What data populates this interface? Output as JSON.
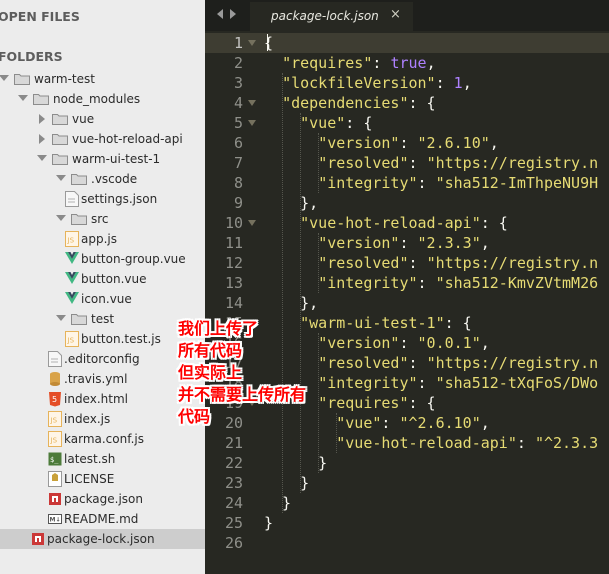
{
  "sidebar": {
    "open_files_label": "OPEN FILES",
    "folders_label": "FOLDERS",
    "tree": [
      {
        "label": "warm-test",
        "kind": "folder",
        "state": "open",
        "icon": "folder-open-icon"
      },
      {
        "label": "node_modules",
        "kind": "folder",
        "state": "open",
        "icon": "folder-open-icon"
      },
      {
        "label": "vue",
        "kind": "folder",
        "state": "closed",
        "icon": "folder-icon"
      },
      {
        "label": "vue-hot-reload-api",
        "kind": "folder",
        "state": "closed",
        "icon": "folder-icon"
      },
      {
        "label": "warm-ui-test-1",
        "kind": "folder",
        "state": "open",
        "icon": "folder-open-icon"
      },
      {
        "label": ".vscode",
        "kind": "folder",
        "state": "open",
        "icon": "folder-open-icon"
      },
      {
        "label": "settings.json",
        "kind": "file",
        "icon": "json-file-icon"
      },
      {
        "label": "src",
        "kind": "folder",
        "state": "open",
        "icon": "folder-open-icon"
      },
      {
        "label": "app.js",
        "kind": "file",
        "icon": "js-file-icon"
      },
      {
        "label": "button-group.vue",
        "kind": "file",
        "icon": "vue-file-icon"
      },
      {
        "label": "button.vue",
        "kind": "file",
        "icon": "vue-file-icon"
      },
      {
        "label": "icon.vue",
        "kind": "file",
        "icon": "vue-file-icon"
      },
      {
        "label": "test",
        "kind": "folder",
        "state": "open",
        "icon": "folder-open-icon"
      },
      {
        "label": "button.test.js",
        "kind": "file",
        "icon": "js-file-icon"
      },
      {
        "label": ".editorconfig",
        "kind": "file",
        "icon": "file-icon"
      },
      {
        "label": ".travis.yml",
        "kind": "file",
        "icon": "database-file-icon"
      },
      {
        "label": "index.html",
        "kind": "file",
        "icon": "html-file-icon"
      },
      {
        "label": "index.js",
        "kind": "file",
        "icon": "js-file-icon"
      },
      {
        "label": "karma.conf.js",
        "kind": "file",
        "icon": "js-file-icon"
      },
      {
        "label": "latest.sh",
        "kind": "file",
        "icon": "shell-file-icon"
      },
      {
        "label": "LICENSE",
        "kind": "file",
        "icon": "license-file-icon"
      },
      {
        "label": "package.json",
        "kind": "file",
        "icon": "npm-file-icon"
      },
      {
        "label": "README.md",
        "kind": "file",
        "icon": "markdown-file-icon"
      },
      {
        "label": "package-lock.json",
        "kind": "file",
        "icon": "npm-file-icon",
        "selected": true
      }
    ]
  },
  "tab": {
    "title": "package-lock.json",
    "close_glyph": "×"
  },
  "editor": {
    "current_line": 1,
    "lines": [
      {
        "n": "1",
        "text": "{"
      },
      {
        "n": "2",
        "text": "  \"requires\": true,"
      },
      {
        "n": "3",
        "text": "  \"lockfileVersion\": 1,"
      },
      {
        "n": "4",
        "text": "  \"dependencies\": {"
      },
      {
        "n": "5",
        "text": "    \"vue\": {"
      },
      {
        "n": "6",
        "text": "      \"version\": \"2.6.10\","
      },
      {
        "n": "7",
        "text": "      \"resolved\": \"https://registry.n"
      },
      {
        "n": "8",
        "text": "      \"integrity\": \"sha512-ImThpeNU9H"
      },
      {
        "n": "9",
        "text": "    },"
      },
      {
        "n": "10",
        "text": "    \"vue-hot-reload-api\": {"
      },
      {
        "n": "11",
        "text": "      \"version\": \"2.3.3\","
      },
      {
        "n": "12",
        "text": "      \"resolved\": \"https://registry.n"
      },
      {
        "n": "13",
        "text": "      \"integrity\": \"sha512-KmvZVtmM26"
      },
      {
        "n": "14",
        "text": "    },"
      },
      {
        "n": "15",
        "text": "    \"warm-ui-test-1\": {"
      },
      {
        "n": "16",
        "text": "      \"version\": \"0.0.1\","
      },
      {
        "n": "17",
        "text": "      \"resolved\": \"https://registry.n"
      },
      {
        "n": "18",
        "text": "      \"integrity\": \"sha512-tXqFoS/DWo"
      },
      {
        "n": "19",
        "text": "      \"requires\": {"
      },
      {
        "n": "20",
        "text": "        \"vue\": \"^2.6.10\","
      },
      {
        "n": "21",
        "text": "        \"vue-hot-reload-api\": \"^2.3.3"
      },
      {
        "n": "22",
        "text": "      }"
      },
      {
        "n": "23",
        "text": "    }"
      },
      {
        "n": "24",
        "text": "  }"
      },
      {
        "n": "25",
        "text": "}"
      },
      {
        "n": "26",
        "text": ""
      }
    ]
  },
  "annotation": {
    "lines": [
      "我们上传了",
      "所有代码",
      "但实际上",
      "并不需要上传所有",
      "代码"
    ]
  },
  "colors": {
    "string": "#e6db74",
    "keyword_constant": "#ae81ff",
    "annotation": "#ff0000",
    "vue_icon": "#41b883",
    "js_icon": "#e6b35a",
    "html_icon": "#e44d26",
    "npm_icon": "#cb3837"
  }
}
